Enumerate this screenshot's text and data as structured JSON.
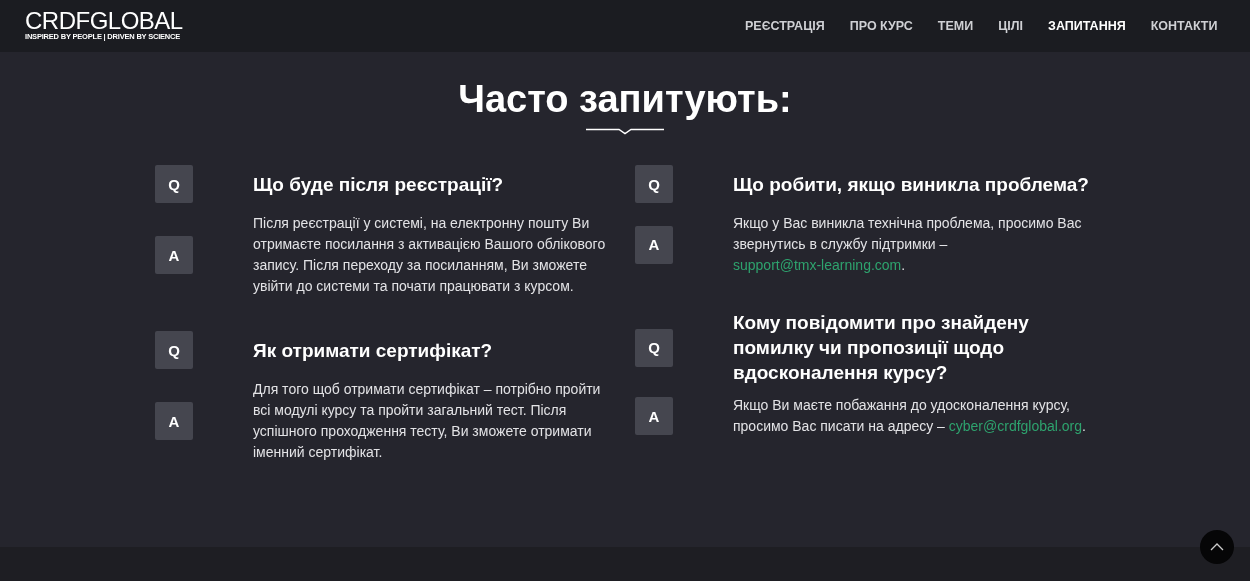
{
  "header": {
    "logo": "CRDFGLOBAL",
    "tagline": "INSPIRED BY PEOPLE | DRIVEN BY SCIENCE",
    "nav": [
      {
        "label": "РЕЄСТРАЦІЯ",
        "selected": false
      },
      {
        "label": "ПРО КУРС",
        "selected": false
      },
      {
        "label": "ТЕМИ",
        "selected": false
      },
      {
        "label": "ЦІЛІ",
        "selected": false
      },
      {
        "label": "ЗАПИТАННЯ",
        "selected": true
      },
      {
        "label": "КОНТАКТИ",
        "selected": false
      }
    ]
  },
  "title": "Часто запитують:",
  "columns": [
    [
      {
        "q_badge": "Q",
        "question": "Що буде після реєстрації?",
        "a_badge": "A",
        "answer": [
          {
            "kind": "text",
            "text": "Після реєстрації у системі, на електронну пошту Ви отримаєте посилання з активацією Вашого облікового запису. Після переходу за посиланням, Ви зможете увійти до системи та почати працювати з курсом."
          }
        ]
      },
      {
        "q_badge": "Q",
        "question": "Як отримати сертифікат?",
        "a_badge": "A",
        "answer": [
          {
            "kind": "text",
            "text": "Для того щоб отримати сертифікат – потрібно пройти всі модулі курсу та пройти загальний тест. Після успішного проходження тесту, Ви зможете отримати іменний сертифікат."
          }
        ]
      }
    ],
    [
      {
        "q_badge": "Q",
        "question": "Що робити, якщо виникла проблема?",
        "a_badge": "A",
        "answer": [
          {
            "kind": "text",
            "text": "Якщо у Вас виникла технічна проблема, просимо Вас звернутись в службу підтримки – "
          },
          {
            "kind": "link",
            "text": "support@tmx-learning.com"
          },
          {
            "kind": "text",
            "text": "."
          }
        ]
      },
      {
        "q_badge": "Q",
        "question": "Кому повідомити про знайдену помилку чи пропозиції щодо вдосконалення курсу?",
        "a_badge": "A",
        "answer": [
          {
            "kind": "text",
            "text": "Якщо Ви маєте побажання до удосконалення курсу, просимо Вас писати на адресу – "
          },
          {
            "kind": "link",
            "text": "cyber@crdfglobal.org"
          },
          {
            "kind": "text",
            "text": "."
          }
        ]
      }
    ]
  ]
}
